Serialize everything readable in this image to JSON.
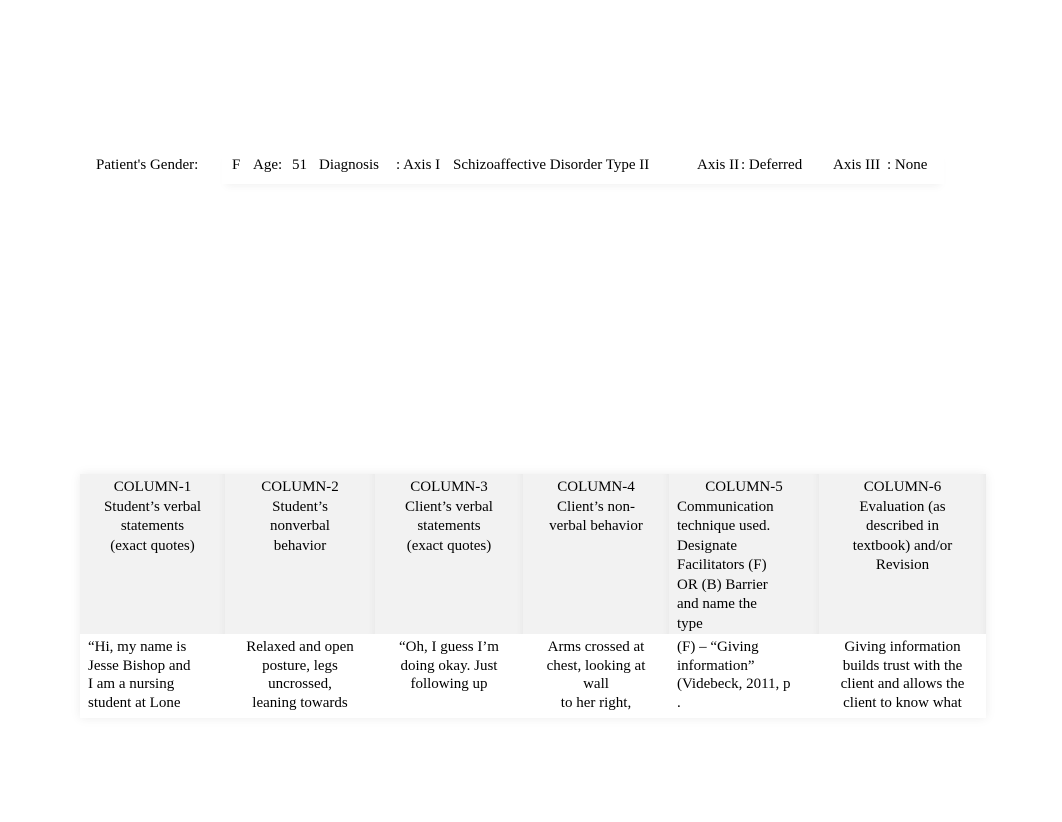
{
  "patient_info": {
    "gender_label": "Patient's Gender:",
    "gender_value": "F",
    "age_label": "Age:",
    "age_value": "51",
    "diagnosis_label": "Diagnosis",
    "axis1_label": ": Axis I",
    "axis1_value": "Schizoaffective Disorder Type II",
    "axis2_label": "Axis II",
    "axis2_value": ": Deferred",
    "axis3_label": "Axis III",
    "axis3_value": ":  None"
  },
  "table": {
    "columns": [
      {
        "id": "COLUMN-1",
        "lines": [
          "Student’s verbal",
          "statements",
          "(exact quotes)"
        ]
      },
      {
        "id": "COLUMN-2",
        "lines": [
          "Student’s",
          "nonverbal",
          "behavior"
        ]
      },
      {
        "id": "COLUMN-3",
        "lines": [
          "Client’s verbal",
          "statements",
          "(exact quotes)"
        ]
      },
      {
        "id": "COLUMN-4",
        "lines": [
          "Client’s non-",
          "verbal behavior"
        ]
      },
      {
        "id": "COLUMN-5",
        "lines": [
          "Communication",
          "technique used.",
          "Designate",
          "Facilitators (F)",
          "OR (B) Barrier",
          "and name the",
          "type"
        ]
      },
      {
        "id": "COLUMN-6",
        "lines": [
          "Evaluation (as",
          "described in",
          "textbook) and/or",
          "Revision"
        ]
      }
    ],
    "rows": [
      {
        "cells": [
          [
            "“Hi, my name is",
            "Jesse Bishop and",
            "I am a nursing",
            "student at Lone"
          ],
          [
            "Relaxed and open",
            "posture, legs",
            "uncrossed,",
            "leaning towards"
          ],
          [
            "“Oh, I guess I’m",
            "doing okay. Just",
            "following up"
          ],
          [
            "Arms crossed at",
            "chest, looking at",
            "wall",
            "to her right,"
          ],
          [
            "(F) – “Giving",
            "information”",
            "(Videbeck, 2011, p",
            "."
          ],
          [
            "Giving information",
            "builds trust with the",
            "client and allows the",
            "client to know what"
          ]
        ]
      }
    ]
  }
}
